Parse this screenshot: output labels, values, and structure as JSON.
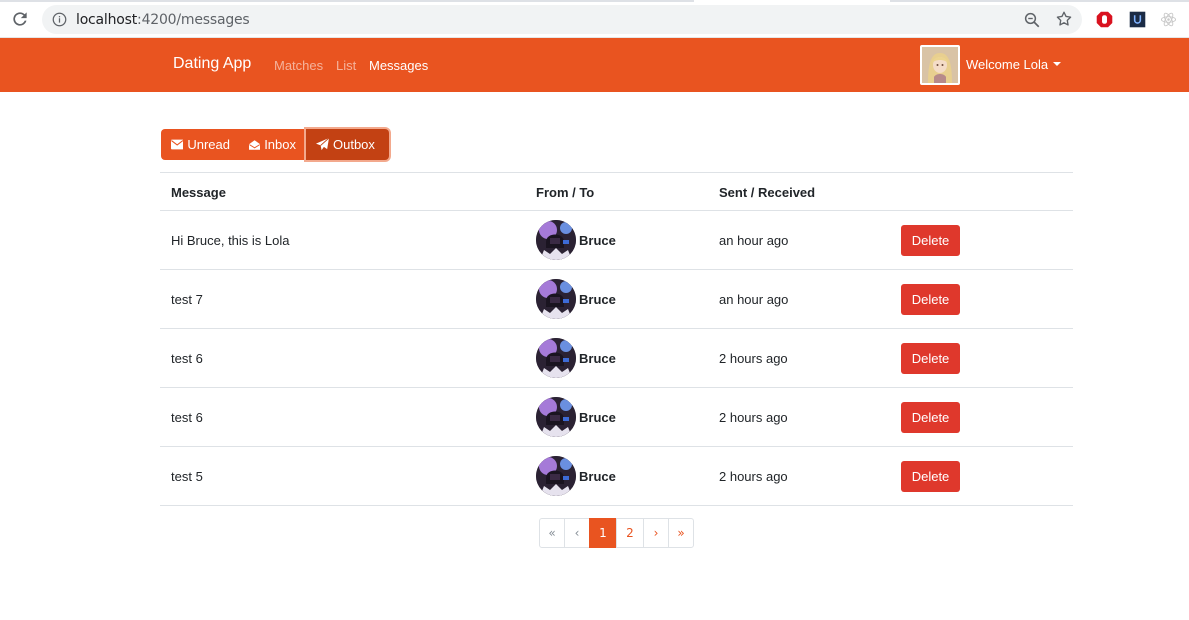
{
  "browser": {
    "url_host": "localhost",
    "url_path": ":4200/messages"
  },
  "navbar": {
    "brand": "Dating App",
    "links": [
      "Matches",
      "List",
      "Messages"
    ],
    "active_link": "Messages",
    "welcome": "Welcome Lola",
    "color": "#e95420"
  },
  "filters": {
    "unread": "Unread",
    "inbox": "Inbox",
    "outbox": "Outbox",
    "active": "Outbox"
  },
  "table": {
    "headers": [
      "Message",
      "From / To",
      "Sent / Received"
    ],
    "rows": [
      {
        "message": "Hi Bruce, this is Lola",
        "name": "Bruce",
        "time": "an hour ago",
        "action": "Delete"
      },
      {
        "message": "test 7",
        "name": "Bruce",
        "time": "an hour ago",
        "action": "Delete"
      },
      {
        "message": "test 6",
        "name": "Bruce",
        "time": "2 hours ago",
        "action": "Delete"
      },
      {
        "message": "test 6",
        "name": "Bruce",
        "time": "2 hours ago",
        "action": "Delete"
      },
      {
        "message": "test 5",
        "name": "Bruce",
        "time": "2 hours ago",
        "action": "Delete"
      }
    ]
  },
  "pagination": {
    "first": "«",
    "prev": "‹",
    "pages": [
      "1",
      "2"
    ],
    "active_page": "1",
    "next": "›",
    "last": "»"
  },
  "colors": {
    "accent": "#e95420",
    "danger": "#df382c"
  }
}
